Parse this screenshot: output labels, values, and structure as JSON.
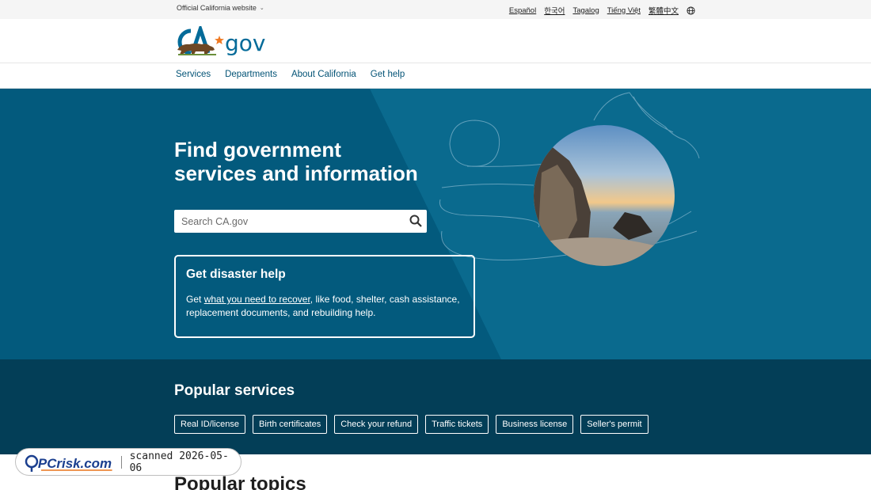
{
  "utility": {
    "official_label": "Official California website",
    "languages": [
      "Español",
      "한국어",
      "Tagalog",
      "Tiếng Việt",
      "繁體中文"
    ]
  },
  "brand": {
    "logo_text": "gov",
    "logo_prefix": "CA"
  },
  "nav": {
    "items": [
      "Services",
      "Departments",
      "About California",
      "Get help"
    ]
  },
  "hero": {
    "title": "Find government services and information",
    "search_placeholder": "Search CA.gov",
    "disaster": {
      "title": "Get disaster help",
      "text_before": "Get ",
      "link": "what you need to recover",
      "text_after": ", like food, shelter, cash assistance, replacement documents, and rebuilding help."
    }
  },
  "popular": {
    "title": "Popular services",
    "chips": [
      "Real ID/license",
      "Birth certificates",
      "Check your refund",
      "Traffic tickets",
      "Business license",
      "Seller's permit"
    ]
  },
  "topics": {
    "title": "Popular topics"
  },
  "watermark": {
    "brand": "PCrisk.com",
    "scanned": "scanned 2026-05-06"
  },
  "colors": {
    "hero": "#035a7d",
    "popular": "#033e57",
    "accent": "#035376"
  }
}
